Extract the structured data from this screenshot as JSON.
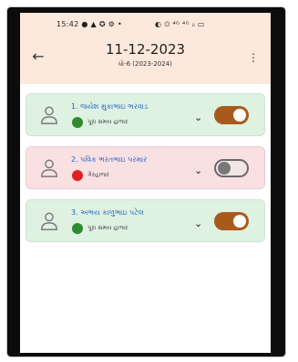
{
  "status_bar": {
    "time": "15:42",
    "left_icons": "● ▲ ✪ ⚙ •",
    "right_icons": "◐ ⏲ ⁴ᴳ ⁴ᴳ ᵢₗ ▭"
  },
  "appbar": {
    "title": "11-12-2023",
    "subtitle": "ધો-6 (2023-2024)"
  },
  "students": [
    {
      "name": "1. જયેશ મુકાભાઇ ભરવાડ",
      "status_label": "પૂરા સમય હાજર",
      "status_color": "#2e8b2e",
      "present": true
    },
    {
      "name": "2. પવિક ભરતભાઇ પરમાર",
      "status_label": "ગેરહાજર",
      "status_color": "#e02020",
      "present": false
    },
    {
      "name": "3. અભય કાળુભાઇ પટેલ",
      "status_label": "પૂરા સમય હાજર",
      "status_color": "#2e8b2e",
      "present": true
    }
  ],
  "icons": {
    "back": "arrow-left-icon",
    "menu": "more-vert-icon",
    "avatar": "person-outline-icon",
    "expand": "chevron-down-icon"
  }
}
